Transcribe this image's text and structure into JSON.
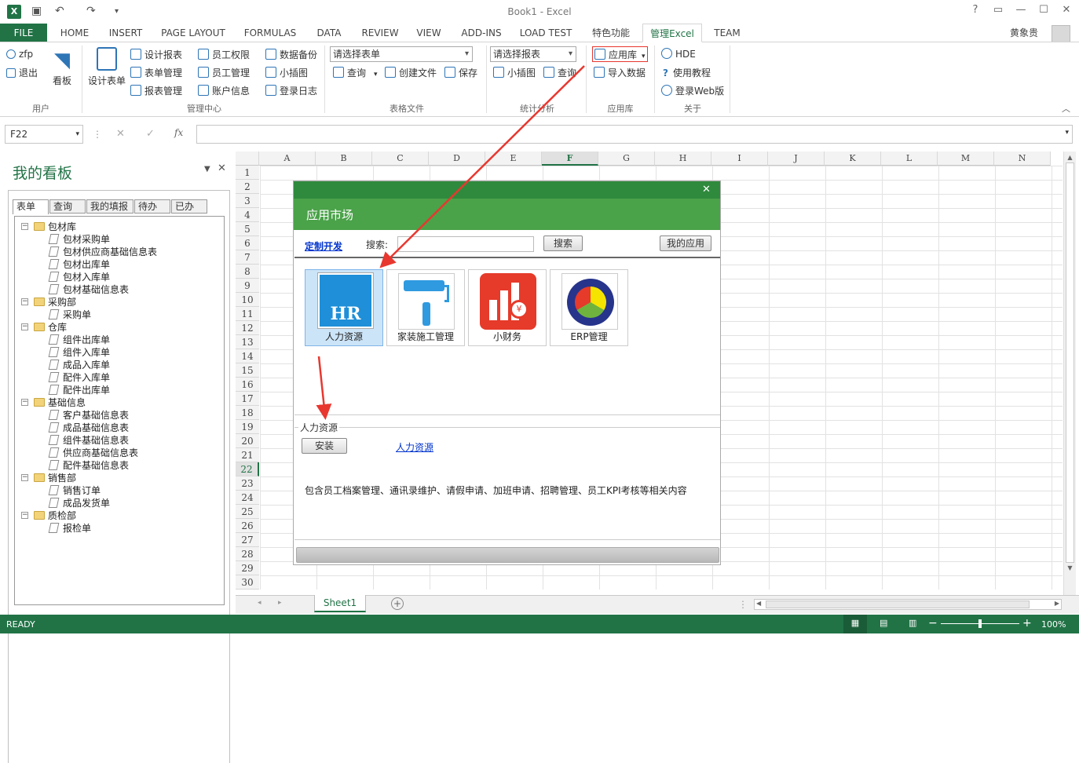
{
  "title": "Book1 - Excel",
  "tabs": [
    "FILE",
    "HOME",
    "INSERT",
    "PAGE LAYOUT",
    "FORMULAS",
    "DATA",
    "REVIEW",
    "VIEW",
    "ADD-INS",
    "LOAD TEST",
    "特色功能",
    "管理Excel",
    "TEAM"
  ],
  "user_name": "黄象贵",
  "ribbon": {
    "user": {
      "login": "zfp",
      "logout": "退出",
      "board": "看板",
      "group": "用户"
    },
    "mgmt": {
      "design_form": "设计表单",
      "design_report": "设计报表",
      "form_mgmt": "表单管理",
      "report_mgmt": "报表管理",
      "emp_perm": "员工权限",
      "emp_mgmt": "员工管理",
      "acct_info": "账户信息",
      "data_backup": "数据备份",
      "mini_chart": "小插图",
      "login_log": "登录日志",
      "group": "管理中心"
    },
    "tablefile": {
      "select_form": "请选择表单",
      "query": "查询",
      "create_file": "创建文件",
      "save": "保存",
      "group": "表格文件"
    },
    "stats": {
      "select_report": "请选择报表",
      "mini_chart": "小插图",
      "query": "查询",
      "group": "统计分析"
    },
    "applib": {
      "app_lib": "应用库",
      "import_data": "导入数据",
      "group": "应用库"
    },
    "about": {
      "hde": "HDE",
      "tutorial": "使用教程",
      "web_login": "登录Web版",
      "group": "关于"
    }
  },
  "name_box": "F22",
  "pane": {
    "title": "我的看板",
    "tabs": [
      "表单",
      "查询",
      "我的填报",
      "待办",
      "已办"
    ],
    "tree": [
      {
        "label": "包材库",
        "children": [
          "包材采购单",
          "包材供应商基础信息表",
          "包材出库单",
          "包材入库单",
          "包材基础信息表"
        ]
      },
      {
        "label": "采购部",
        "children": [
          "采购单"
        ]
      },
      {
        "label": "仓库",
        "children": [
          "组件出库单",
          "组件入库单",
          "成品入库单",
          "配件入库单",
          "配件出库单"
        ]
      },
      {
        "label": "基础信息",
        "children": [
          "客户基础信息表",
          "成品基础信息表",
          "组件基础信息表",
          "供应商基础信息表",
          "配件基础信息表"
        ]
      },
      {
        "label": "销售部",
        "children": [
          "销售订单",
          "成品发货单"
        ]
      },
      {
        "label": "质检部",
        "children": [
          "报检单"
        ]
      }
    ]
  },
  "columns": [
    "A",
    "B",
    "C",
    "D",
    "E",
    "F",
    "G",
    "H",
    "I",
    "J",
    "K",
    "L",
    "M",
    "N"
  ],
  "rows": [
    "1",
    "2",
    "3",
    "4",
    "5",
    "6",
    "7",
    "8",
    "9",
    "10",
    "11",
    "12",
    "13",
    "14",
    "15",
    "16",
    "17",
    "18",
    "19",
    "20",
    "21",
    "22",
    "23",
    "24",
    "25",
    "26",
    "27",
    "28",
    "29",
    "30"
  ],
  "sheet_tab": "Sheet1",
  "status": {
    "ready": "READY",
    "zoom": "100%"
  },
  "dialog": {
    "title": "应用市场",
    "custom_dev": "定制开发",
    "search_label": "搜索:",
    "search_button": "搜索",
    "my_apps": "我的应用",
    "apps": [
      {
        "name": "人力资源",
        "icon": "hr-icon"
      },
      {
        "name": "家装施工管理",
        "icon": "paint-roller-icon"
      },
      {
        "name": "小财务",
        "icon": "finance-icon"
      },
      {
        "name": "ERP管理",
        "icon": "erp-icon"
      }
    ],
    "detail": {
      "section": "人力资源",
      "install": "安装",
      "link": "人力资源",
      "description": "包含员工档案管理、通讯录维护、请假申请、加班申请、招聘管理、员工KPI考核等相关内容"
    }
  },
  "colors": {
    "excel_green": "#217346",
    "dialog_green": "#4aa249",
    "arrow_red": "#e8372f"
  }
}
